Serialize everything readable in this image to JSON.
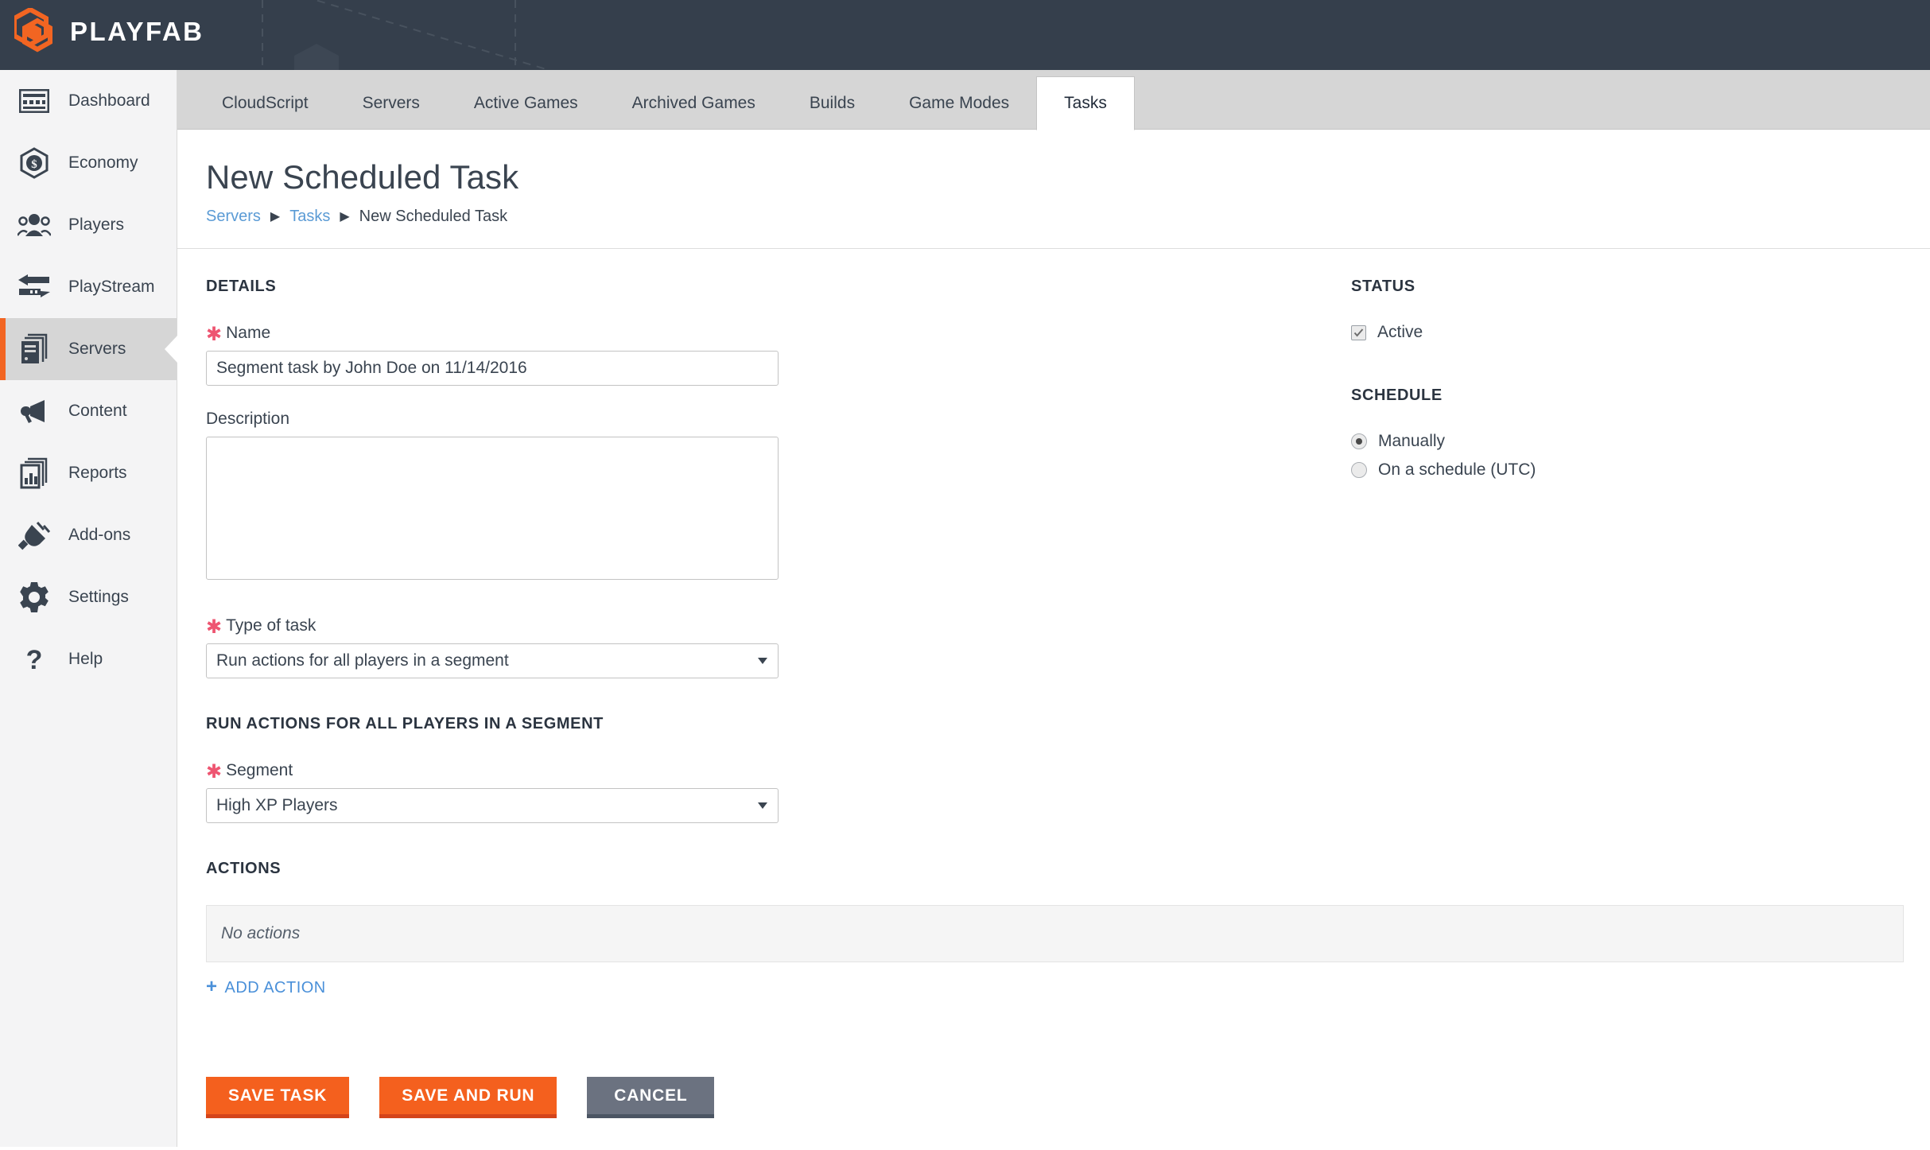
{
  "brand": {
    "name": "PLAYFAB",
    "logo_icon": "playfab-hex-logo",
    "bar_color": "#353f4c",
    "accent_color": "#f26522"
  },
  "sidebar": {
    "items": [
      {
        "label": "Dashboard",
        "icon": "dashboard-icon",
        "active": false
      },
      {
        "label": "Economy",
        "icon": "economy-icon",
        "active": false
      },
      {
        "label": "Players",
        "icon": "players-icon",
        "active": false
      },
      {
        "label": "PlayStream",
        "icon": "playstream-icon",
        "active": false
      },
      {
        "label": "Servers",
        "icon": "servers-icon",
        "active": true
      },
      {
        "label": "Content",
        "icon": "content-icon",
        "active": false
      },
      {
        "label": "Reports",
        "icon": "reports-icon",
        "active": false
      },
      {
        "label": "Add-ons",
        "icon": "addons-icon",
        "active": false
      },
      {
        "label": "Settings",
        "icon": "settings-icon",
        "active": false
      },
      {
        "label": "Help",
        "icon": "help-icon",
        "active": false
      }
    ]
  },
  "tabs": [
    {
      "label": "CloudScript",
      "active": false
    },
    {
      "label": "Servers",
      "active": false
    },
    {
      "label": "Active Games",
      "active": false
    },
    {
      "label": "Archived Games",
      "active": false
    },
    {
      "label": "Builds",
      "active": false
    },
    {
      "label": "Game Modes",
      "active": false
    },
    {
      "label": "Tasks",
      "active": true
    }
  ],
  "page": {
    "title": "New Scheduled Task",
    "breadcrumb": [
      {
        "label": "Servers",
        "link": true
      },
      {
        "label": "Tasks",
        "link": true
      },
      {
        "label": "New Scheduled Task",
        "link": false
      }
    ],
    "breadcrumb_separator": "▶"
  },
  "details": {
    "section_title": "DETAILS",
    "name": {
      "label": "Name",
      "required_marker": "✱",
      "value": "Segment task by John Doe on 11/14/2016",
      "placeholder": ""
    },
    "description": {
      "label": "Description",
      "value": "",
      "placeholder": ""
    },
    "type_of_task": {
      "label": "Type of task",
      "required_marker": "✱",
      "selected": "Run actions for all players in a segment"
    }
  },
  "segment_section": {
    "section_title": "RUN ACTIONS FOR ALL PLAYERS IN A SEGMENT",
    "segment": {
      "label": "Segment",
      "required_marker": "✱",
      "selected": "High XP Players"
    }
  },
  "actions_section": {
    "section_title": "ACTIONS",
    "empty_text": "No actions",
    "add_action_label": "ADD ACTION",
    "add_action_plus": "+"
  },
  "buttons": {
    "save_task": "SAVE TASK",
    "save_and_run": "SAVE AND RUN",
    "cancel": "CANCEL",
    "primary_color": "#f4601e",
    "secondary_color": "#6b7280"
  },
  "status": {
    "section_title": "STATUS",
    "active_label": "Active",
    "active_checked": true
  },
  "schedule": {
    "section_title": "SCHEDULE",
    "options": [
      {
        "label": "Manually",
        "selected": true
      },
      {
        "label": "On a schedule (UTC)",
        "selected": false
      }
    ]
  }
}
